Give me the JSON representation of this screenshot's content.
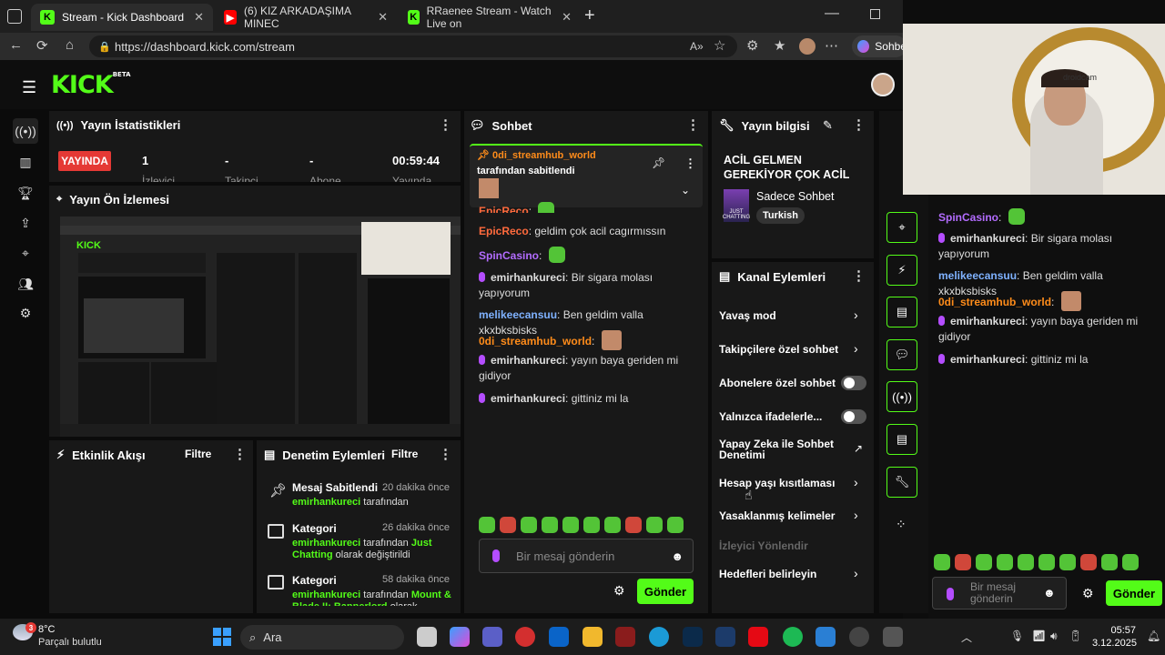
{
  "browser": {
    "tabs": [
      {
        "title": "Stream - Kick Dashboard",
        "icon": "kick-icon"
      },
      {
        "title": "(6) KIZ ARKADAŞIMA MINEC",
        "icon": "youtube-icon"
      },
      {
        "title": "RRaenee Stream - Watch Live on",
        "icon": "kick-icon"
      }
    ],
    "url": "https://dashboard.kick.com/stream",
    "profile_label": "Sohbe"
  },
  "logo": {
    "text": "KICK",
    "badge": "BETA"
  },
  "stats": {
    "title": "Yayın İstatistikleri",
    "live_badge": "YAYINDA",
    "values": [
      "1",
      "-",
      "-",
      "00:59:44"
    ],
    "labels": [
      "İzleyici",
      "Takipçi",
      "Abone",
      "Yayında"
    ]
  },
  "preview": {
    "title": "Yayın Ön İzlemesi"
  },
  "activity": {
    "title": "Etkinlik Akışı",
    "filter": "Filtre"
  },
  "moderation": {
    "title": "Denetim Eylemleri",
    "filter": "Filtre",
    "items": [
      {
        "title": "Mesaj Sabitlendi",
        "time": "20 dakika önce",
        "user": "emirhankureci",
        "text": " tarafından"
      },
      {
        "title": "Kategori",
        "time": "26 dakika önce",
        "user": "emirhankureci",
        "text": " tarafından ",
        "green": "Just Chatting",
        "tail": " olarak değiştirildi"
      },
      {
        "title": "Kategori",
        "time": "58 dakika önce",
        "user": "emirhankureci",
        "text": " tarafından ",
        "green": "Mount & Blade II: Bannerlord",
        "tail": " olarak"
      }
    ]
  },
  "chat": {
    "title": "Sohbet",
    "pinned": {
      "user": "0di_streamhub_world",
      "by": "tarafından sabitlendi"
    },
    "messages": [
      {
        "user": "EpicReco",
        "color": "#ff6a3d",
        "text": ""
      },
      {
        "user": "EpicReco",
        "color": "#ff6a3d",
        "text": " geldim çok acil cagırmıssın"
      },
      {
        "user": "SpinCasino",
        "color": "#b36cff",
        "text": ""
      },
      {
        "user": "emirhankureci",
        "color": "#ffffff",
        "text": " Bir sigara molası yapıyorum"
      },
      {
        "user": "melikeecansuu",
        "color": "#7fb2ff",
        "text": " Ben geldim valla xkxbksbisks"
      },
      {
        "user": "0di_streamhub_world",
        "color": "#ff8c1a",
        "text": ""
      },
      {
        "user": "emirhankureci",
        "color": "#ffffff",
        "text": " yayın baya geriden mi gidiyor"
      },
      {
        "user": "emirhankureci",
        "color": "#ffffff",
        "text": " gittiniz mi la"
      }
    ],
    "input_placeholder": "Bir mesaj gönderin",
    "send": "Gönder"
  },
  "info": {
    "title": "Yayın bilgisi",
    "stream_title": "ACİL GELMEN GEREKİYOR ÇOK ACİL",
    "category": "Sadece Sohbet",
    "tag": "Turkish",
    "thumb_text": "JUST CHATTING"
  },
  "actions": {
    "title": "Kanal Eylemleri",
    "items": [
      {
        "label": "Yavaş mod",
        "type": "chevron"
      },
      {
        "label": "Takipçilere özel sohbet",
        "type": "chevron"
      },
      {
        "label": "Abonelere özel sohbet",
        "type": "toggle"
      },
      {
        "label": "Yalnızca ifadelerle...",
        "type": "toggle"
      },
      {
        "label": "Yapay Zeka ile Sohbet Denetimi",
        "type": "external"
      },
      {
        "label": "Hesap yaşı kısıtlaması",
        "type": "chevron"
      },
      {
        "label": "Yasaklanmış kelimeler",
        "type": "chevron"
      },
      {
        "label": "İzleyici Yönlendir",
        "type": "disabled"
      },
      {
        "label": "Hedefleri belirleyin",
        "type": "chevron"
      }
    ]
  },
  "overlay_chat": {
    "messages": [
      {
        "user": "SpinCasino",
        "color": "#b36cff",
        "text": ""
      },
      {
        "user": "emirhankureci",
        "color": "#ffffff",
        "text": " Bir sigara molası yapıyorum"
      },
      {
        "user": "melikeecansuu",
        "color": "#7fb2ff",
        "text": " Ben geldim valla xkxbksbisks"
      },
      {
        "user": "0di_streamhub_world",
        "color": "#ff8c1a",
        "text": ""
      },
      {
        "user": "emirhankureci",
        "color": "#ffffff",
        "text": " yayın baya geriden mi gidiyor"
      },
      {
        "user": "emirhankureci",
        "color": "#ffffff",
        "text": " gittiniz mi la"
      }
    ],
    "input_placeholder": "Bir mesaj gönderin",
    "send": "Gönder"
  },
  "webcam": {
    "label": "droidcam"
  },
  "taskbar": {
    "weather_temp": "8°C",
    "weather_desc": "Parçalı bulutlu",
    "weather_badge": "3",
    "search": "Ara",
    "time": "05:57",
    "date": "3.12.2025"
  }
}
